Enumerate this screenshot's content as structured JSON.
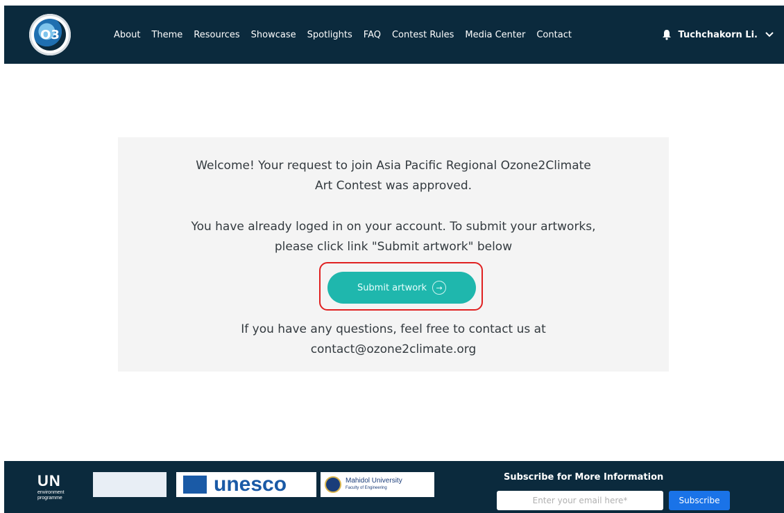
{
  "header": {
    "logo_text": "O3",
    "nav": [
      "About",
      "Theme",
      "Resources",
      "Showcase",
      "Spotlights",
      "FAQ",
      "Contest Rules",
      "Media Center",
      "Contact"
    ],
    "user_name": "Tuchchakorn Li."
  },
  "main": {
    "welcome_line1": "Welcome! Your request to join Asia Pacific Regional Ozone2Climate",
    "welcome_line2": "Art Contest was approved.",
    "login_line1": "You have already loged in on your account. To submit your artworks,",
    "login_line2": "please click link \"Submit artwork\" below",
    "submit_label": "Submit artwork",
    "contact_line1": "If you have any questions, feel free to contact us at",
    "contact_email": "contact@ozone2climate.org"
  },
  "footer": {
    "unep_big": "UN",
    "unep_lines": [
      "environment",
      "programme"
    ],
    "unesco": "unesco",
    "mahidol_name": "Mahidol University",
    "mahidol_sub": "Faculty of Engineering",
    "subscribe_title": "Subscribe for More Information",
    "email_placeholder": "Enter your email here*",
    "subscribe_label": "Subscribe"
  },
  "colors": {
    "header_bg": "#0b2a3d",
    "accent": "#1fb7ad",
    "highlight": "#e02020",
    "subscribe": "#1a73e8"
  }
}
